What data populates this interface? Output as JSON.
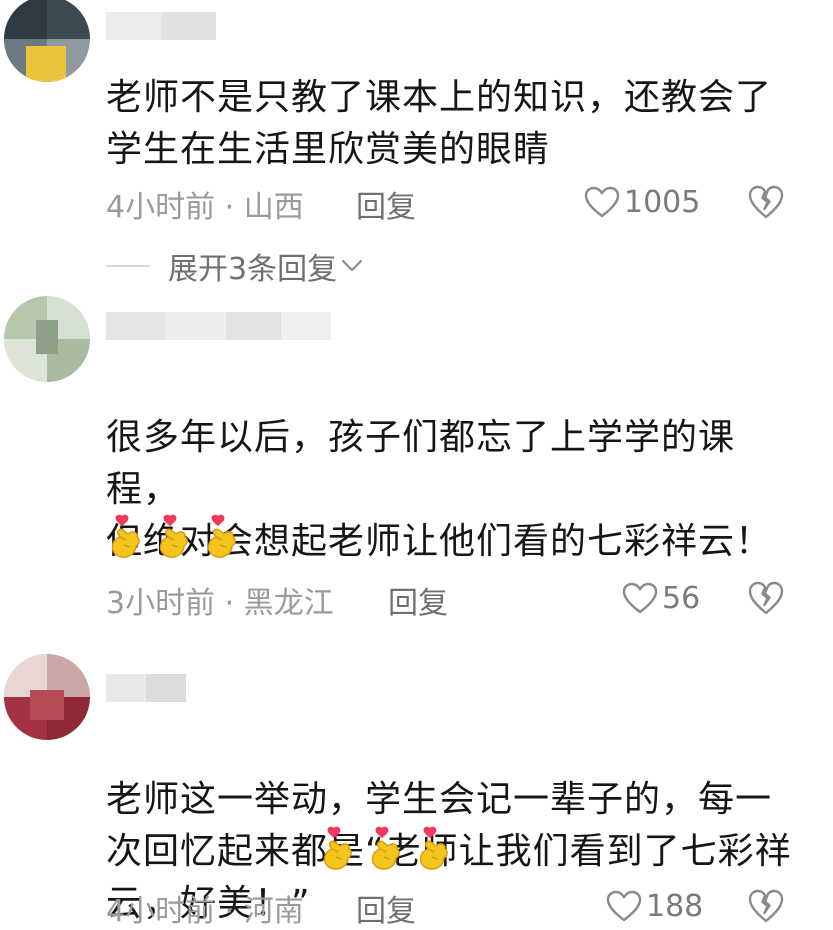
{
  "comments": [
    {
      "text": "老师不是只教了课本上的知识，还教会了\n学生在生活里欣赏美的眼睛",
      "emoji_count": 0,
      "time": "4小时前 · 山西",
      "reply_label": "回复",
      "likes": "1005",
      "expand": {
        "label": "展开3条回复"
      }
    },
    {
      "text": "很多年以后，孩子们都忘了上学学的课\n程，\n但绝对会想起老师让他们看的七彩祥云！",
      "emoji_count": 3,
      "time": "3小时前 · 黑龙江",
      "reply_label": "回复",
      "likes": "56"
    },
    {
      "text": "老师这一举动，学生会记一辈子的，每一\n次回忆起来都是“老师让我们看到了七彩祥\n云，好美！”",
      "emoji_count": 3,
      "time": "4小时前 · 河南",
      "reply_label": "回复",
      "likes": "188"
    }
  ],
  "icons": {
    "emoji": "finger-heart-emoji",
    "like": "heart-outline-icon",
    "dislike": "broken-heart-icon",
    "expand": "chevron-down-icon"
  },
  "colors": {
    "text": "#161616",
    "meta": "#9a9a9a",
    "reply": "#6f6f6f",
    "emoji_yellow": "#f5c51e",
    "emoji_heart": "#ef3a5d"
  }
}
